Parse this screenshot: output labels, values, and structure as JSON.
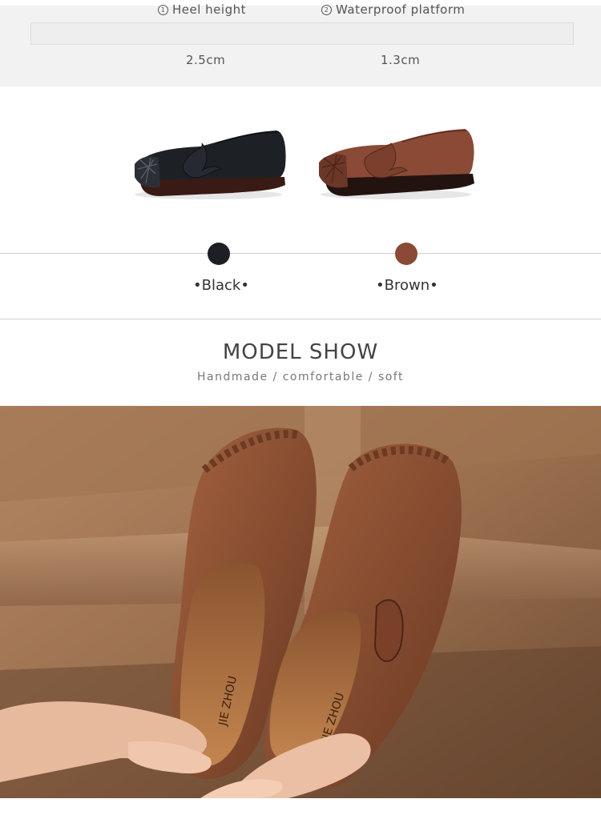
{
  "specs": {
    "heel_label": "Heel height",
    "heel_num": "1",
    "heel_value": "2.5cm",
    "platform_label": "Waterproof platform",
    "platform_num": "2",
    "platform_value": "1.3cm"
  },
  "colors": {
    "black_label": "•Black•",
    "brown_label": "•Brown•",
    "black_hex": "#1c1f24",
    "brown_hex": "#8a4a35"
  },
  "model": {
    "title": "MODEL SHOW",
    "subtitle": "Handmade / comfortable / soft"
  },
  "insole_brand": "JIE ZHOU"
}
